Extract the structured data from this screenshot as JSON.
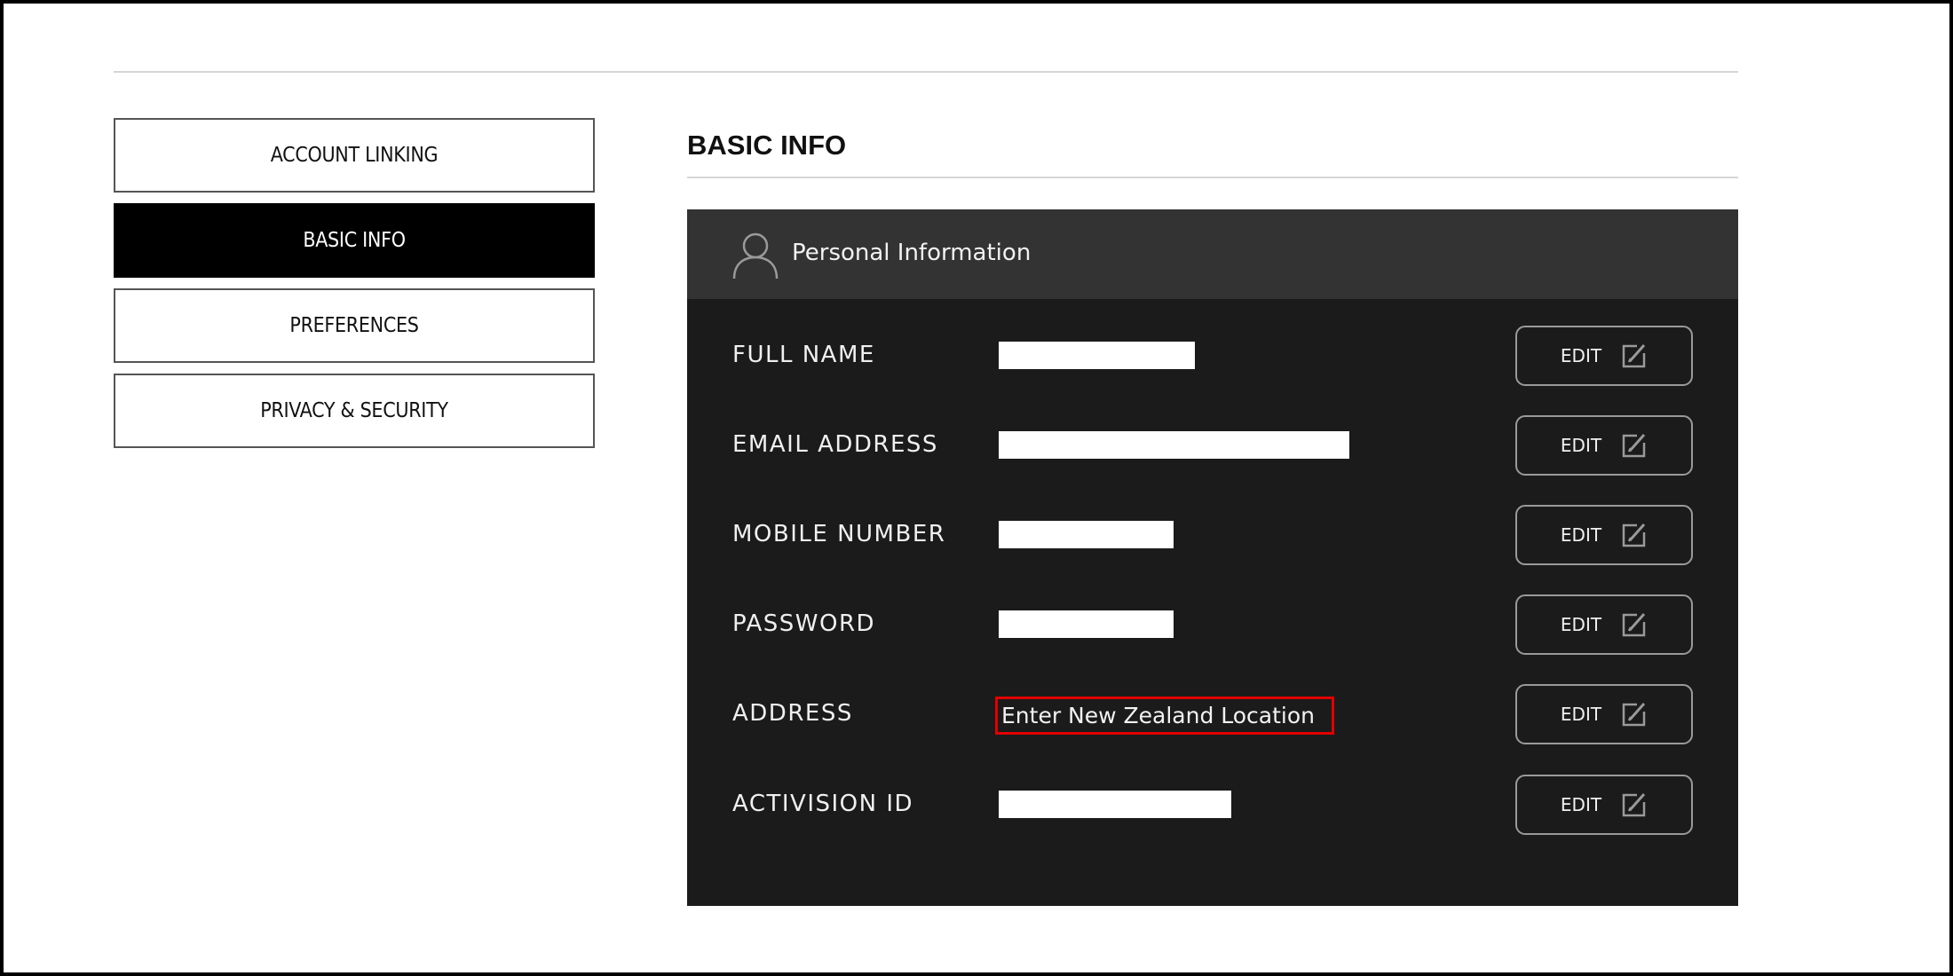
{
  "sidebar": {
    "items": [
      {
        "label": "ACCOUNT LINKING",
        "active": false
      },
      {
        "label": "BASIC INFO",
        "active": true
      },
      {
        "label": "PREFERENCES",
        "active": false
      },
      {
        "label": "PRIVACY & SECURITY",
        "active": false
      }
    ]
  },
  "main": {
    "title": "BASIC INFO",
    "panel": {
      "title": "Personal Information",
      "icon": "user-icon",
      "edit_label": "EDIT",
      "edit_icon": "edit-icon",
      "rows": [
        {
          "label": "FULL NAME",
          "value": "[redacted]"
        },
        {
          "label": "EMAIL ADDRESS",
          "value": "[redacted]"
        },
        {
          "label": "MOBILE NUMBER",
          "value": "[redacted]"
        },
        {
          "label": "PASSWORD",
          "value": "[redacted]"
        },
        {
          "label": "ADDRESS",
          "value": "Enter New Zealand Location"
        },
        {
          "label": "ACTIVISION ID",
          "value": "[redacted]"
        }
      ]
    }
  },
  "colors": {
    "highlight": "#e10000",
    "panel_bg": "#1b1b1b",
    "panel_header_bg": "#333333",
    "active_nav_bg": "#000000"
  }
}
